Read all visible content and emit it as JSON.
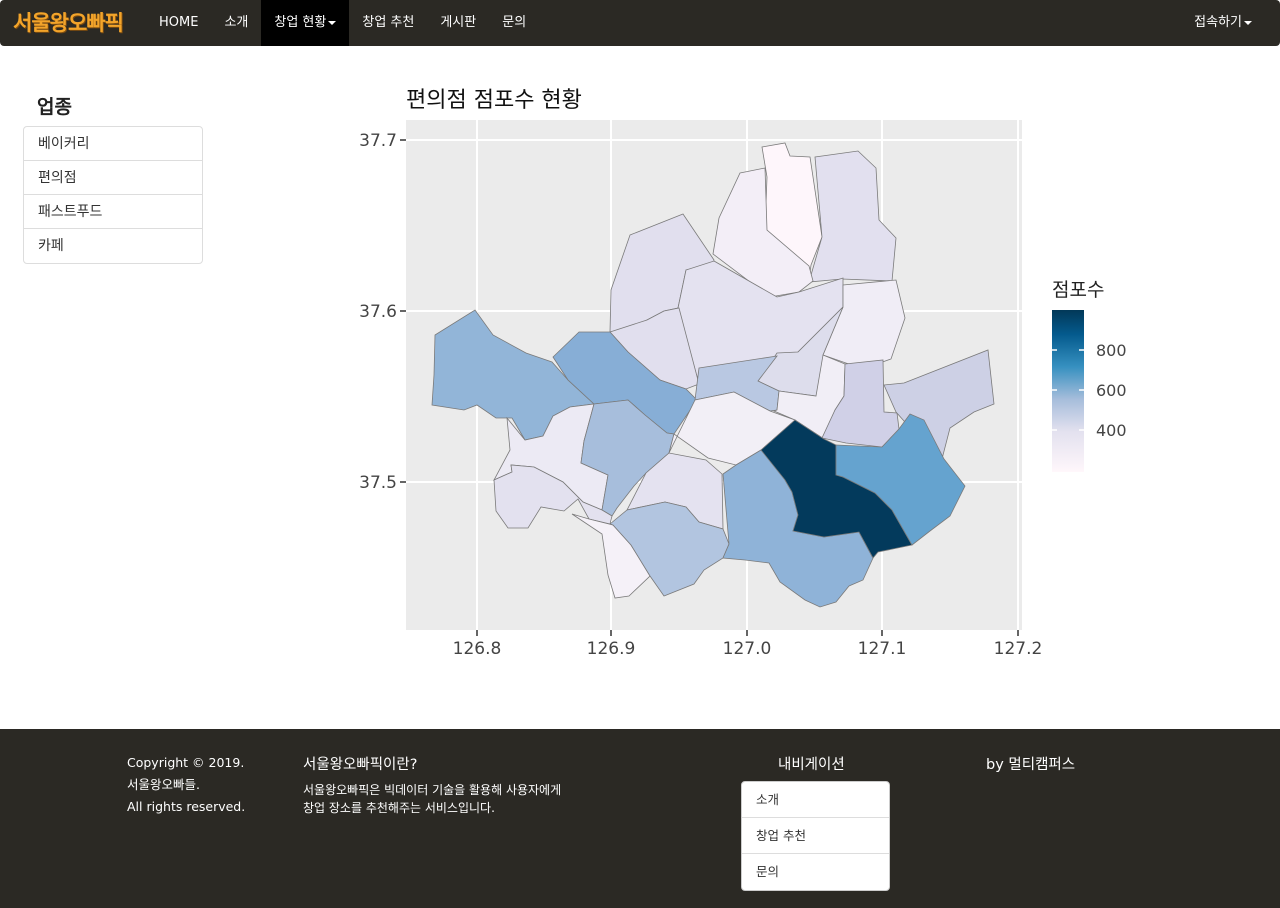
{
  "navbar": {
    "brand": "서울왕오빠픽",
    "items": [
      {
        "label": "HOME"
      },
      {
        "label": "소개"
      },
      {
        "label": "창업 현황"
      },
      {
        "label": "창업 추천"
      },
      {
        "label": "게시판"
      },
      {
        "label": "문의"
      }
    ],
    "active_index": 2,
    "account_label": "접속하기"
  },
  "sidebar": {
    "title": "업종",
    "items": [
      {
        "label": "베이커리"
      },
      {
        "label": "편의점"
      },
      {
        "label": "패스트푸드"
      },
      {
        "label": "카페"
      }
    ]
  },
  "chart_data": {
    "type": "choropleth",
    "title": "편의점 점포수 현황",
    "x_ticks": [
      "126.8",
      "126.9",
      "127.0",
      "127.1",
      "127.2"
    ],
    "y_ticks": [
      "37.5",
      "37.6",
      "37.7"
    ],
    "xlim": [
      126.75,
      127.21
    ],
    "ylim": [
      37.42,
      37.72
    ],
    "legend": {
      "title": "점포수",
      "ticks": [
        "400",
        "600",
        "800"
      ],
      "placement": "right",
      "range": [
        200,
        1000
      ]
    },
    "colors": {
      "low": "#fff7fb",
      "mid": "#a6bddb",
      "high": "#023858",
      "panel": "#ebebeb",
      "grid": "#ffffff",
      "border": "#7a7a7a"
    }
  },
  "footer": {
    "copyright_lines": [
      "Copyright © 2019.",
      "서울왕오빠들.",
      "All rights reserved."
    ],
    "about_title": "서울왕오빠픽이란?",
    "about_lines": [
      "서울왕오빠픽은 빅데이터 기술을 활용해 사용자에게",
      "창업 장소를 추천해주는 서비스입니다."
    ],
    "nav_title": "내비게이션",
    "nav_items": [
      {
        "label": "소개"
      },
      {
        "label": "창업 추천"
      },
      {
        "label": "문의"
      }
    ],
    "byline": "by 멀티캠퍼스"
  }
}
